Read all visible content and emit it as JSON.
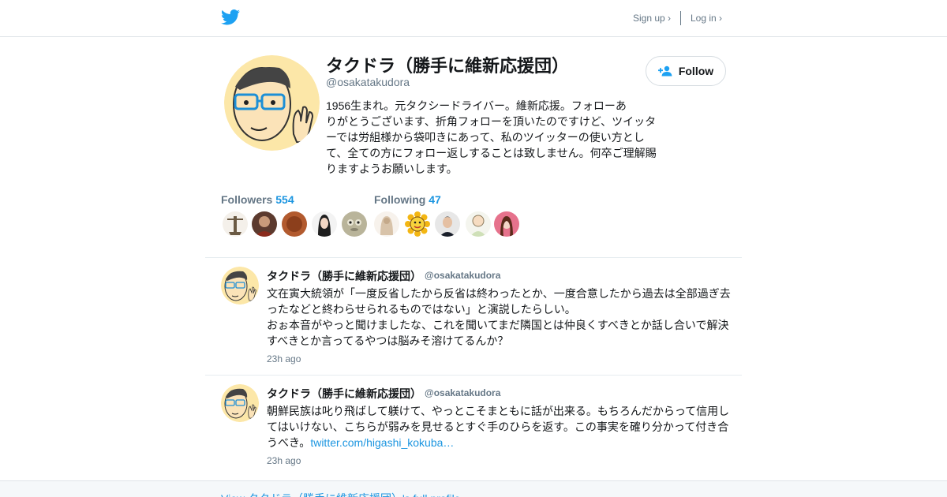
{
  "header": {
    "logo_icon": "twitter-bird-icon",
    "signup_label": "Sign up ›",
    "login_label": "Log in ›"
  },
  "profile": {
    "name": "タクドラ（勝手に維新応援団）",
    "handle": "@osakatakudora",
    "follow_label": "Follow",
    "bio_lines": [
      "1956生まれ。元タクシードライバー。維新応援。フォローあ",
      "りがとうございます、折角フォローを頂いたのですけど、ツイッタ",
      "ーでは労組様から袋叩きにあって、私のツイッターの使い方とし",
      "て、全ての方にフォロー返しすることは致しません。何卒ご理解賜",
      "りますようお願いします。"
    ]
  },
  "stats": {
    "followers_label": "Followers",
    "followers_count": "554",
    "following_label": "Following",
    "following_count": "47"
  },
  "tweets": [
    {
      "name": "タクドラ（勝手に維新応援団）",
      "handle": "@osakatakudora",
      "lines": [
        "文在寅大統領が「一度反省したから反省は終わったとか、一度合意したから過去は全部過ぎ去",
        "ったなどと終わらせられるものではない」と演説したらしい。",
        "おぉ本音がやっと聞けましたな、これを聞いてまだ隣国とは仲良くすべきとか話し合いで解決",
        "すべきとか言ってるやつは脳みそ溶けてるんか？"
      ],
      "time": "23h ago"
    },
    {
      "name": "タクドラ（勝手に維新応援団）",
      "handle": "@osakatakudora",
      "lines": [
        "朝鮮民族は叱り飛ばして躾けて、やっとこそまともに話が出来る。もちろんだからって信用し",
        "てはいけない、こちらが弱みを見せるとすぐ手のひらを返す。この事実を確り分かって付き合"
      ],
      "last_line_prefix": "うべき。",
      "link": "twitter.com/higashi_kokuba…",
      "time": "23h ago"
    }
  ],
  "footer": {
    "link_label": "View タクドラ（勝手に維新応援団）'s full profile →"
  },
  "colors": {
    "accent": "#1b95e0",
    "muted": "#657786",
    "border": "#e6ecf0"
  }
}
